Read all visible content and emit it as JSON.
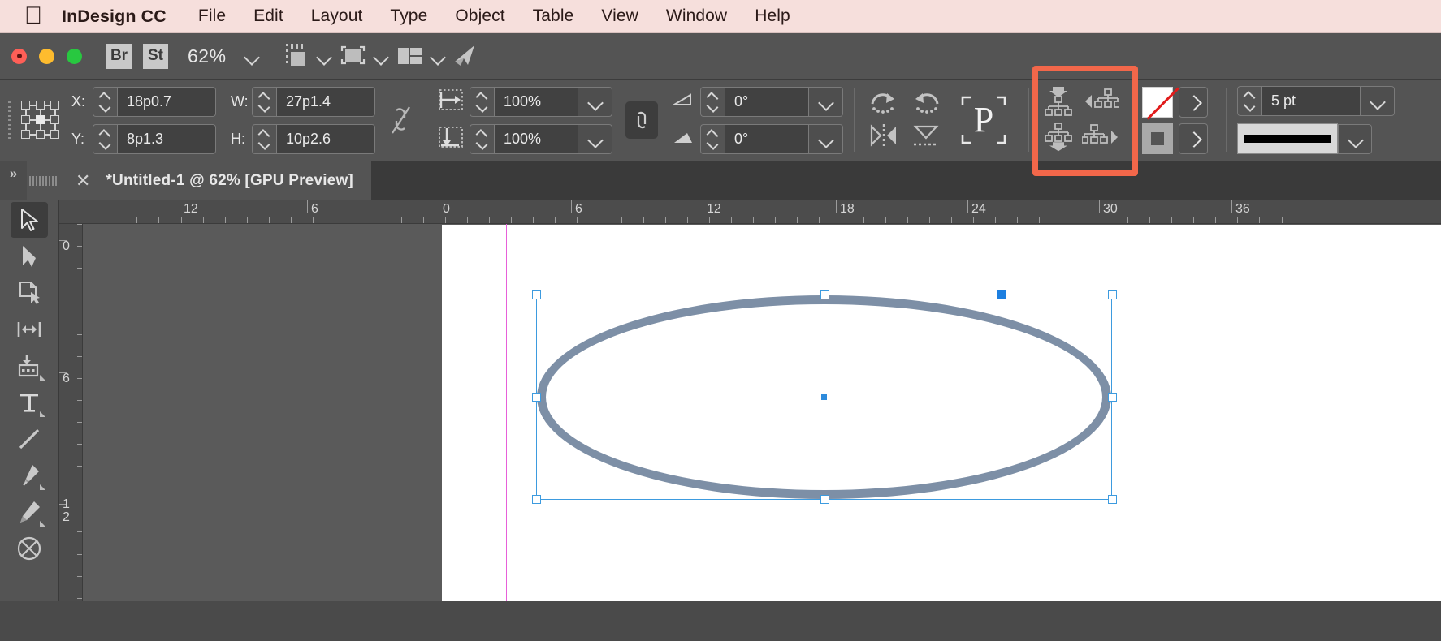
{
  "menubar": {
    "apple_icon": "apple-logo",
    "items": [
      {
        "label": "InDesign CC",
        "bold": true
      },
      {
        "label": "File"
      },
      {
        "label": "Edit"
      },
      {
        "label": "Layout"
      },
      {
        "label": "Type"
      },
      {
        "label": "Object"
      },
      {
        "label": "Table"
      },
      {
        "label": "View"
      },
      {
        "label": "Window"
      },
      {
        "label": "Help"
      }
    ]
  },
  "titlebar": {
    "bridge_label": "Br",
    "stock_label": "St",
    "zoom_level": "62%",
    "zoom_dropdown_icon": "chevron-down-icon",
    "view_options_icon": "screen-mode-icon",
    "view_options_dropdown_icon": "chevron-down-icon",
    "screen_mode_icon": "preview-mode-icon",
    "screen_mode_dropdown_icon": "chevron-down-icon",
    "arrange_icon": "arrange-documents-icon",
    "arrange_dropdown_icon": "chevron-down-icon",
    "workspace_icon": "publish-online-icon"
  },
  "control_panel": {
    "reference_point_name": "reference-point-proxy",
    "reference_point_selected": "center",
    "x_label": "X:",
    "x_value": "18p0.7",
    "y_label": "Y:",
    "y_value": "8p1.3",
    "w_label": "W:",
    "w_value": "27p1.4",
    "h_label": "H:",
    "h_value": "10p2.6",
    "constrain_proportions_icon": "broken-chain-icon",
    "scale_x_icon": "scale-horizontal-icon",
    "scale_x_value": "100%",
    "scale_y_icon": "scale-vertical-icon",
    "scale_y_value": "100%",
    "scale_link_icon": "link-scale-icon",
    "rotation_icon": "rotation-angle-icon",
    "rotation_value": "0°",
    "shear_icon": "shear-angle-icon",
    "shear_value": "0°",
    "rotate_cw_icon": "rotate-clockwise-icon",
    "rotate_ccw_icon": "rotate-counterclockwise-icon",
    "flip_horizontal_icon": "flip-horizontal-icon",
    "flip_vertical_icon": "flip-vertical-icon",
    "text_frame_icon": "text-frame-options-icon",
    "text_frame_letter": "P",
    "bring_forward_icon": "bring-forward-icon",
    "send_backward_icon": "send-backward-icon",
    "align_left_icon": "align-left-icon",
    "align_right_icon": "align-right-icon",
    "fill_swatch_name": "fill-swatch-none",
    "fill_swatch_value": "None",
    "fill_arrow_icon": "chevron-right-icon",
    "stroke_swatch_name": "stroke-swatch",
    "stroke_swatch_value": "Black",
    "stroke_arrow_icon": "chevron-right-icon",
    "stroke_weight_value": "5 pt",
    "stroke_weight_dropdown_icon": "chevron-down-icon",
    "stroke_type_value": "Solid",
    "stroke_type_dropdown_icon": "chevron-down-icon",
    "highlight_color": "#f2674a",
    "highlight_target": "fill-and-stroke-swatches"
  },
  "tabbar": {
    "panel_expander_icon": "double-chevron-right-icon",
    "close_icon": "close-icon",
    "document_title": "*Untitled-1 @ 62% [GPU Preview]"
  },
  "toolbar": {
    "tools": [
      {
        "name": "selection-tool",
        "active": true
      },
      {
        "name": "direct-selection-tool",
        "active": false
      },
      {
        "name": "page-tool",
        "active": false
      },
      {
        "name": "gap-tool",
        "active": false
      },
      {
        "name": "content-collector-tool",
        "active": false
      },
      {
        "name": "type-tool",
        "active": false
      },
      {
        "name": "line-tool",
        "active": false
      },
      {
        "name": "pen-tool",
        "active": false
      },
      {
        "name": "pencil-tool",
        "active": false
      },
      {
        "name": "ellipse-frame-tool",
        "active": false
      }
    ]
  },
  "canvas": {
    "ruler_h_labels": [
      "12",
      "6",
      "0",
      "6",
      "12",
      "18",
      "24",
      "30",
      "36"
    ],
    "ruler_v_labels": [
      "0",
      "6",
      "12"
    ],
    "ruler_units": "picas",
    "selected_object": "ellipse-shape",
    "page_background": "#ffffff",
    "pasteboard_background": "#5a5a5a",
    "ellipse_stroke_color": "#7d8fa6",
    "selection_color": "#3d9bdf",
    "bleed_guide_color": "#e760d9"
  }
}
